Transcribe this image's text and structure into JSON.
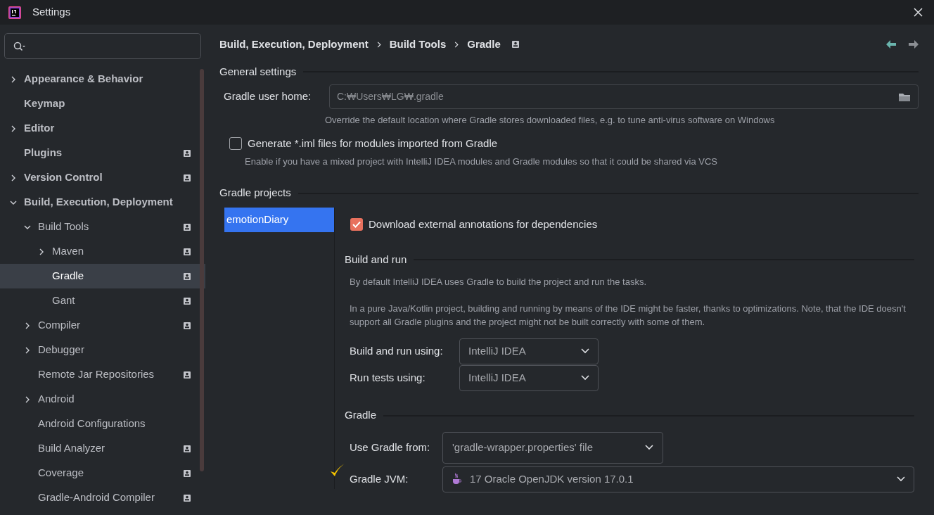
{
  "window": {
    "title": "Settings"
  },
  "sidebar": {
    "items": [
      {
        "label": "Appearance & Behavior",
        "kind": "folder",
        "expanded": false,
        "badge": false,
        "selected": false
      },
      {
        "label": "Keymap",
        "kind": "leaf",
        "badge": false,
        "selected": false
      },
      {
        "label": "Editor",
        "kind": "folder",
        "expanded": false,
        "badge": false,
        "selected": false
      },
      {
        "label": "Plugins",
        "kind": "leaf",
        "badge": true,
        "selected": false
      },
      {
        "label": "Version Control",
        "kind": "folder",
        "expanded": false,
        "badge": true,
        "selected": false
      },
      {
        "label": "Build, Execution, Deployment",
        "kind": "folder",
        "expanded": true,
        "badge": false,
        "selected": false,
        "children": [
          {
            "label": "Build Tools",
            "kind": "folder",
            "expanded": true,
            "badge": true,
            "selected": false,
            "children": [
              {
                "label": "Maven",
                "kind": "folder",
                "expanded": false,
                "badge": true,
                "selected": false
              },
              {
                "label": "Gradle",
                "kind": "leaf",
                "badge": true,
                "selected": true
              },
              {
                "label": "Gant",
                "kind": "leaf",
                "badge": true,
                "selected": false
              }
            ]
          },
          {
            "label": "Compiler",
            "kind": "folder",
            "expanded": false,
            "badge": true,
            "selected": false
          },
          {
            "label": "Debugger",
            "kind": "folder",
            "expanded": false,
            "badge": false,
            "selected": false
          },
          {
            "label": "Remote Jar Repositories",
            "kind": "leaf",
            "badge": true,
            "selected": false
          },
          {
            "label": "Android",
            "kind": "folder",
            "expanded": false,
            "badge": false,
            "selected": false
          },
          {
            "label": "Android Configurations",
            "kind": "leaf",
            "badge": false,
            "selected": false
          },
          {
            "label": "Build Analyzer",
            "kind": "leaf",
            "badge": true,
            "selected": false
          },
          {
            "label": "Coverage",
            "kind": "leaf",
            "badge": true,
            "selected": false
          },
          {
            "label": "Gradle-Android Compiler",
            "kind": "leaf",
            "badge": true,
            "selected": false
          }
        ]
      }
    ]
  },
  "breadcrumb": [
    "Build, Execution, Deployment",
    "Build Tools",
    "Gradle"
  ],
  "general": {
    "title": "General settings",
    "user_home_label": "Gradle user home:",
    "user_home_value": "C:₩Users₩LG₩.gradle",
    "user_home_hint": "Override the default location where Gradle stores downloaded files, e.g. to tune anti-virus software on Windows",
    "iml_label": "Generate *.iml files for modules imported from Gradle",
    "iml_checked": false,
    "iml_hint": "Enable if you have a mixed project with IntelliJ IDEA modules and Gradle modules so that it could be shared via VCS"
  },
  "projects": {
    "title": "Gradle projects",
    "items": [
      {
        "label": "emotionDiary",
        "selected": true
      }
    ],
    "annotations_label": "Download external annotations for dependencies",
    "annotations_checked": true,
    "build_run_title": "Build and run",
    "build_run_text1": "By default IntelliJ IDEA uses Gradle to build the project and run the tasks.",
    "build_run_text2": "In a pure Java/Kotlin project, building and running by means of the IDE might be faster, thanks to optimizations. Note, that the IDE doesn't support all Gradle plugins and the project might not be built correctly with some of them.",
    "build_using_label": "Build and run using:",
    "build_using_value": "IntelliJ IDEA",
    "tests_using_label": "Run tests using:",
    "tests_using_value": "IntelliJ IDEA",
    "gradle_title": "Gradle",
    "use_from_label": "Use Gradle from:",
    "use_from_value": "'gradle-wrapper.properties' file",
    "jvm_label": "Gradle JVM:",
    "jvm_value": "17 Oracle OpenJDK version 17.0.1",
    "jvm_marked": true
  }
}
